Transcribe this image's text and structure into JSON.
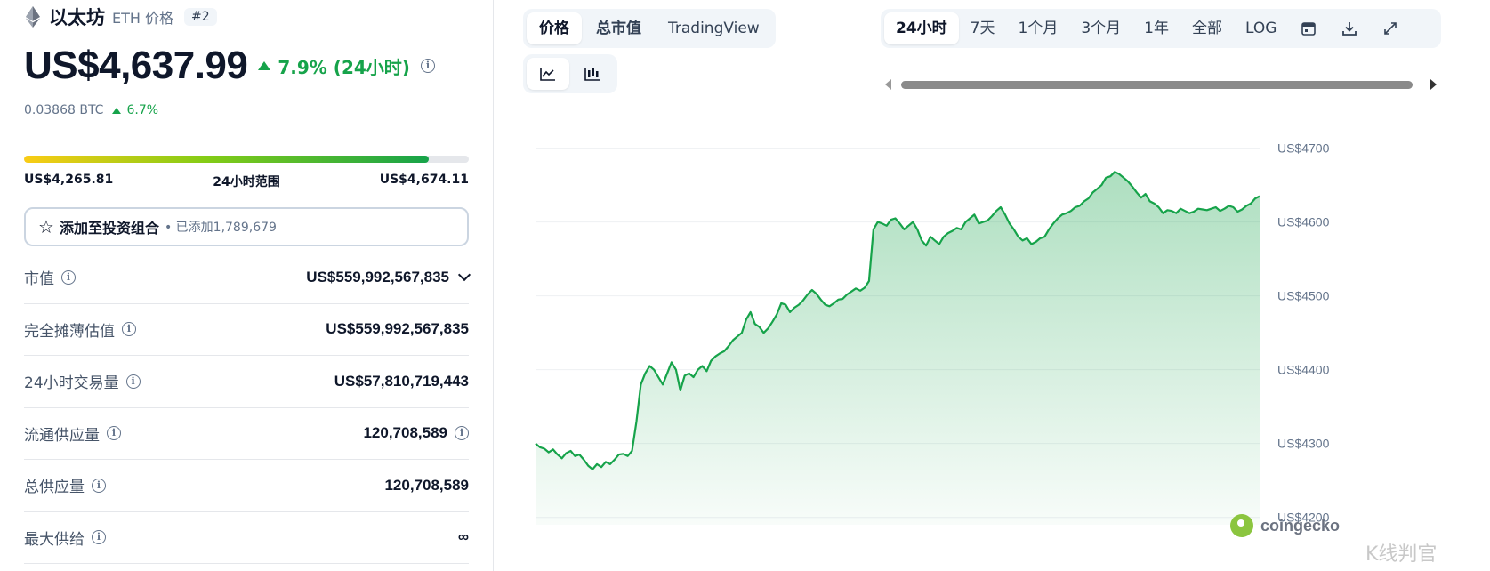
{
  "coin": {
    "name": "以太坊",
    "symbol_label": "ETH 价格",
    "rank": "#2",
    "price": "US$4,637.99",
    "change_24h": "7.9% (24小时)",
    "btc_price": "0.03868 BTC",
    "btc_change": "6.7%"
  },
  "range": {
    "low": "US$4,265.81",
    "label": "24小时范围",
    "high": "US$4,674.11",
    "fill_fraction": 0.91
  },
  "portfolio": {
    "label": "添加至投资组合",
    "count": "• 已添加1,789,679"
  },
  "stats": [
    {
      "label": "市值",
      "value": "US$559,992,567,835"
    },
    {
      "label": "完全摊薄估值",
      "value": "US$559,992,567,835"
    },
    {
      "label": "24小时交易量",
      "value": "US$57,810,719,443"
    },
    {
      "label": "流通供应量",
      "value": "120,708,589"
    },
    {
      "label": "总供应量",
      "value": "120,708,589"
    },
    {
      "label": "最大供给",
      "value": "∞"
    }
  ],
  "tabs": [
    "价格",
    "总市值",
    "TradingView"
  ],
  "range_tabs": [
    "24小时",
    "7天",
    "1个月",
    "3个月",
    "1年",
    "全部",
    "LOG"
  ],
  "icons": {
    "line_chart": "line-chart-icon",
    "candle_chart": "candlestick-chart-icon",
    "calendar": "calendar-icon",
    "download": "download-icon",
    "fullscreen": "expand-icon"
  },
  "colors": {
    "accent_green": "#16a34a",
    "muted": "#64748b"
  },
  "watermark": {
    "brand": "coingecko",
    "corner": "K线判官"
  },
  "chart_data": {
    "type": "area",
    "ylabels": [
      "US$4700",
      "US$4600",
      "US$4500",
      "US$4400",
      "US$4300",
      "US$4200"
    ],
    "yticks": [
      4700,
      4600,
      4500,
      4400,
      4300,
      4200
    ],
    "ylim": [
      4190,
      4720
    ],
    "values": [
      4300,
      4295,
      4293,
      4288,
      4292,
      4285,
      4280,
      4287,
      4290,
      4283,
      4285,
      4278,
      4270,
      4265,
      4272,
      4268,
      4275,
      4272,
      4278,
      4285,
      4286,
      4283,
      4290,
      4330,
      4380,
      4395,
      4405,
      4400,
      4390,
      4380,
      4395,
      4410,
      4400,
      4372,
      4392,
      4395,
      4390,
      4400,
      4405,
      4398,
      4412,
      4418,
      4422,
      4425,
      4432,
      4440,
      4445,
      4450,
      4468,
      4478,
      4462,
      4458,
      4450,
      4456,
      4465,
      4475,
      4490,
      4488,
      4478,
      4484,
      4488,
      4494,
      4502,
      4508,
      4503,
      4495,
      4488,
      4486,
      4490,
      4495,
      4496,
      4502,
      4506,
      4510,
      4507,
      4511,
      4520,
      4590,
      4600,
      4598,
      4595,
      4603,
      4605,
      4598,
      4590,
      4595,
      4600,
      4590,
      4575,
      4568,
      4580,
      4575,
      4570,
      4580,
      4585,
      4588,
      4592,
      4590,
      4600,
      4605,
      4610,
      4598,
      4600,
      4602,
      4608,
      4615,
      4620,
      4610,
      4598,
      4590,
      4580,
      4575,
      4578,
      4570,
      4573,
      4578,
      4580,
      4590,
      4598,
      4605,
      4610,
      4612,
      4615,
      4620,
      4622,
      4628,
      4632,
      4640,
      4645,
      4650,
      4660,
      4662,
      4668,
      4665,
      4660,
      4655,
      4648,
      4640,
      4633,
      4638,
      4628,
      4625,
      4620,
      4612,
      4616,
      4615,
      4612,
      4618,
      4615,
      4612,
      4614,
      4618,
      4617,
      4616,
      4618,
      4620,
      4615,
      4618,
      4622,
      4620,
      4614,
      4617,
      4622,
      4625,
      4632,
      4635
    ]
  }
}
